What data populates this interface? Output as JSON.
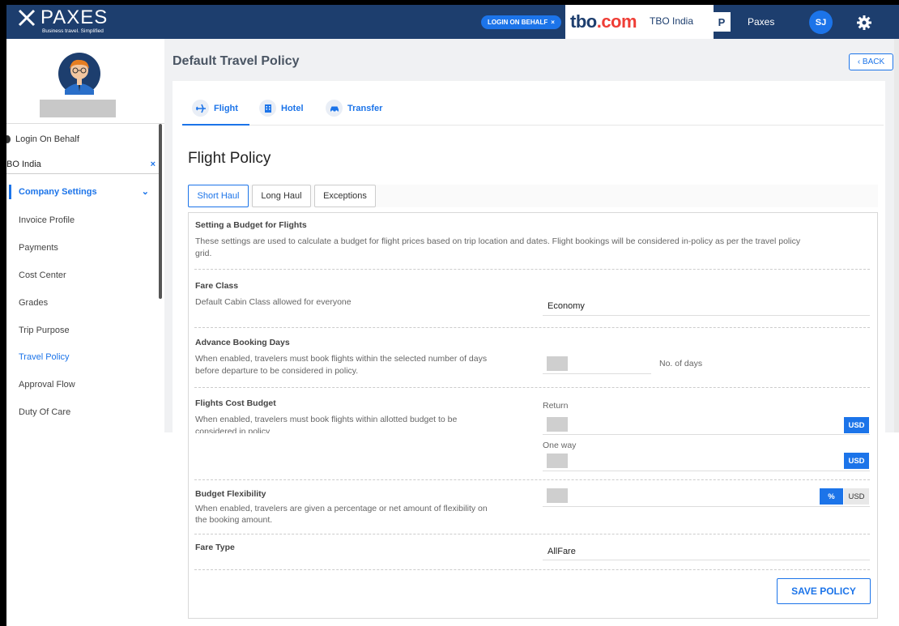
{
  "header": {
    "logo_text": "PAXES",
    "logo_tagline": "Business travel. Simplified",
    "login_on_behalf_badge": "LOGIN ON BEHALF",
    "badge_close": "×",
    "tbo_logo_main": "tbo",
    "tbo_logo_suffix": ".com",
    "company_name": "TBO India",
    "profile_initial": "P",
    "profile_name": "Paxes",
    "user_initials": "SJ"
  },
  "sidebar": {
    "login_on_behalf_label": "Login On Behalf",
    "selected_company": "BO India",
    "clear_symbol": "×",
    "company_settings_label": "Company Settings",
    "items": [
      {
        "label": "Invoice Profile"
      },
      {
        "label": "Payments"
      },
      {
        "label": "Cost Center"
      },
      {
        "label": "Grades"
      },
      {
        "label": "Trip Purpose"
      },
      {
        "label": "Travel Policy"
      },
      {
        "label": "Approval Flow"
      },
      {
        "label": "Duty Of Care"
      }
    ]
  },
  "main": {
    "page_title": "Default Travel Policy",
    "back_label": "‹ BACK",
    "tabs": [
      {
        "label": "Flight"
      },
      {
        "label": "Hotel"
      },
      {
        "label": "Transfer"
      }
    ],
    "policy_title": "Flight Policy",
    "subtabs": [
      {
        "label": "Short Haul"
      },
      {
        "label": "Long Haul"
      },
      {
        "label": "Exceptions"
      }
    ],
    "budget_section": {
      "title": "Setting a Budget for Flights",
      "desc_line1": "These settings are used to calculate a budget for flight prices based on trip location and dates. Flight bookings will be considered in-policy as per the travel policy",
      "desc_line2": "grid."
    },
    "fare_class": {
      "title": "Fare Class",
      "desc": "Default Cabin Class allowed for everyone",
      "value": "Economy"
    },
    "advance_booking": {
      "title": "Advance Booking Days",
      "desc_line1": "When enabled, travelers must book flights within the selected number of days",
      "desc_line2": "before departure to be considered in policy.",
      "unit_label": "No. of days"
    },
    "cost_budget": {
      "title": "Flights Cost Budget",
      "desc_line1": "When enabled, travelers must book flights within allotted budget to be",
      "desc_line2": "considered in policy",
      "return_label": "Return",
      "oneway_label": "One way",
      "currency": "USD"
    },
    "budget_flex": {
      "title": "Budget Flexibility",
      "desc_line1": "When enabled, travelers are given a percentage or net amount of flexibility on",
      "desc_line2": "the booking amount.",
      "percent_label": "%",
      "currency_label": "USD"
    },
    "fare_type": {
      "title": "Fare Type",
      "value": "AllFare"
    },
    "save_label": "SAVE POLICY"
  }
}
